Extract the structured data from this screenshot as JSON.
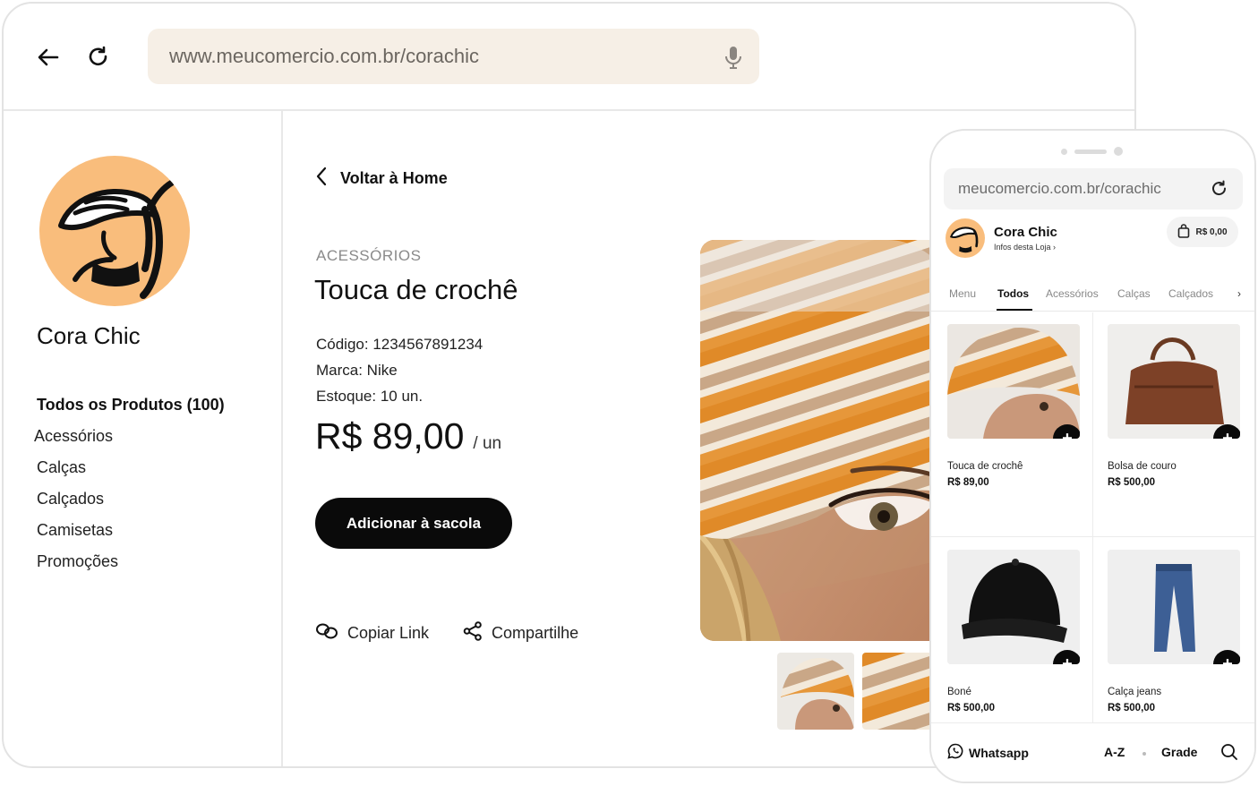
{
  "browser": {
    "url": "www.meucomercio.com.br/corachic",
    "back_icon": "arrow-left-icon",
    "reload_icon": "reload-icon",
    "mic_icon": "microphone-icon"
  },
  "store": {
    "name": "Cora Chic",
    "brand_color": "#f9bd7c"
  },
  "sidebar": {
    "items": [
      {
        "label": "Todos os Produtos (100)",
        "active": true
      },
      {
        "label": "Acessórios"
      },
      {
        "label": "Calças"
      },
      {
        "label": "Calçados"
      },
      {
        "label": "Camisetas"
      },
      {
        "label": "Promoções"
      }
    ]
  },
  "product": {
    "back_label": "Voltar à Home",
    "category": "ACESSÓRIOS",
    "title": "Touca de crochê",
    "code": "Código: 1234567891234",
    "brand": "Marca: Nike",
    "stock": "Estoque: 10 un.",
    "price": "R$ 89,00",
    "unit": "/ un",
    "add_label": "Adicionar à sacola",
    "copy_label": "Copiar Link",
    "share_label": "Compartilhe"
  },
  "mobile": {
    "url": "meucomercio.com.br/corachic",
    "store_name": "Cora Chic",
    "store_info": "Infos desta Loja",
    "cart_total": "R$ 0,00",
    "tabs": [
      {
        "label": "Menu"
      },
      {
        "label": "Todos",
        "active": true
      },
      {
        "label": "Acessórios"
      },
      {
        "label": "Calças"
      },
      {
        "label": "Calçados"
      }
    ],
    "products": [
      {
        "name": "Touca de crochê",
        "price": "R$ 89,00"
      },
      {
        "name": "Bolsa de couro",
        "price": "R$ 500,00"
      },
      {
        "name": "Boné",
        "price": "R$ 500,00"
      },
      {
        "name": "Calça jeans",
        "price": "R$ 500,00"
      }
    ],
    "bottom": {
      "whatsapp": "Whatsapp",
      "sort": "A-Z",
      "view": "Grade"
    }
  }
}
